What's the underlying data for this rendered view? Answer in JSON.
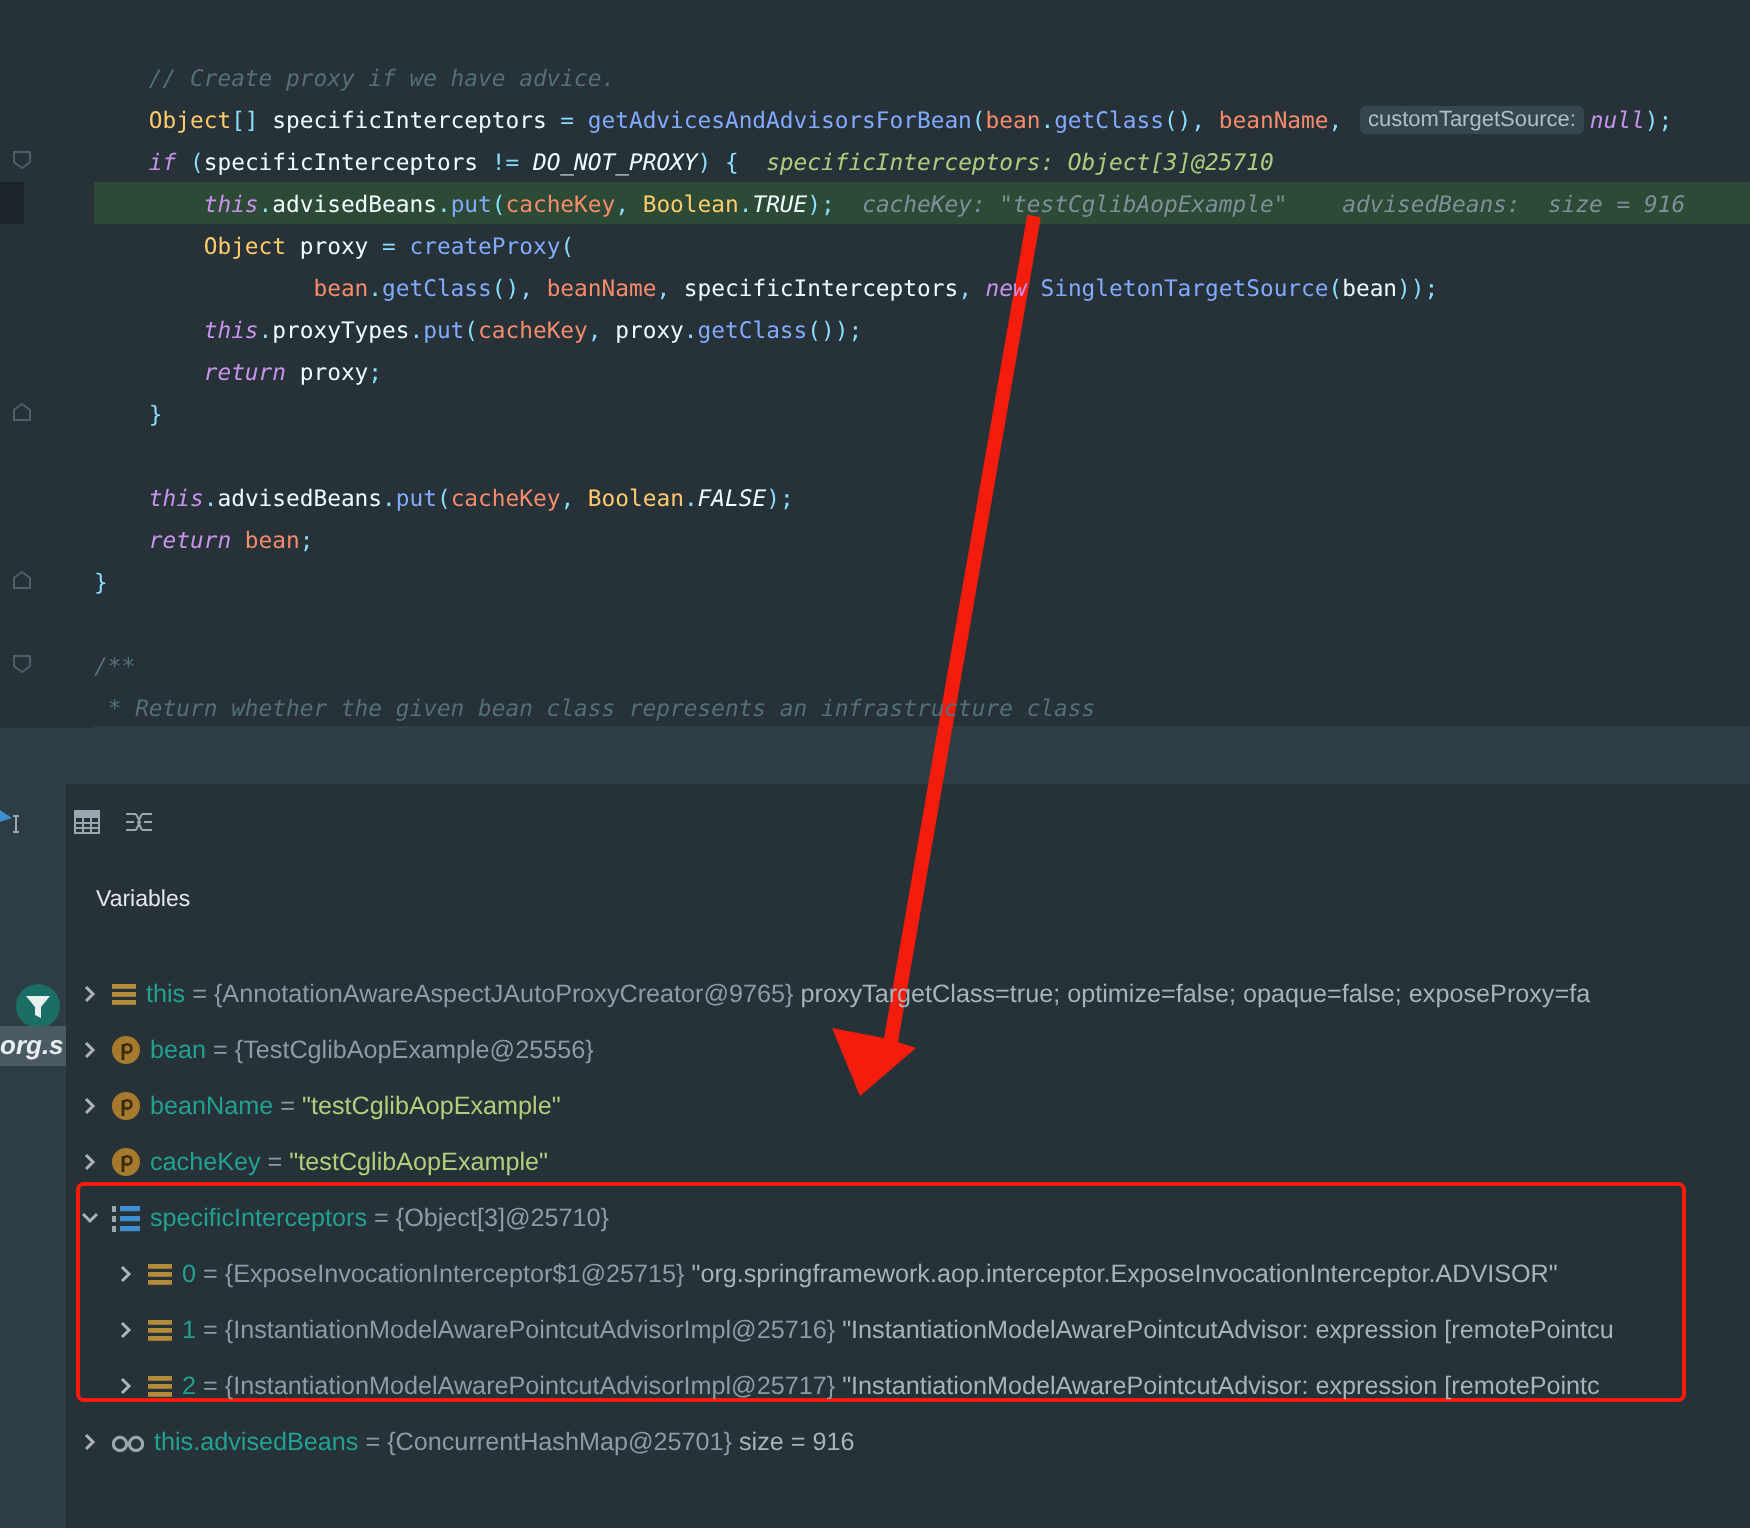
{
  "editor": {
    "lines": [
      {
        "highlighted": false,
        "kind": "plain",
        "segments": [
          {
            "kind": "comment",
            "text": "    // Create proxy if we have advice."
          }
        ]
      },
      {
        "highlighted": false,
        "kind": "plain",
        "segments": [
          {
            "kind": "type",
            "text": "    Object"
          },
          {
            "kind": "punct",
            "text": "[]"
          },
          {
            "kind": "plain",
            "text": " specificInterceptors "
          },
          {
            "kind": "punct",
            "text": "= "
          },
          {
            "kind": "method",
            "text": "getAdvicesAndAdvisorsForBean"
          },
          {
            "kind": "punct",
            "text": "("
          },
          {
            "kind": "param",
            "text": "bean"
          },
          {
            "kind": "punct",
            "text": "."
          },
          {
            "kind": "method",
            "text": "getClass"
          },
          {
            "kind": "punct",
            "text": "(), "
          },
          {
            "kind": "param",
            "text": "beanName"
          },
          {
            "kind": "punct",
            "text": ", "
          },
          {
            "kind": "inlay",
            "text": "customTargetSource:"
          },
          {
            "kind": "keyword",
            "text": "null"
          },
          {
            "kind": "punct",
            "text": ");"
          }
        ]
      },
      {
        "highlighted": false,
        "kind": "fold_start",
        "segments": [
          {
            "kind": "keyword",
            "text": "    if"
          },
          {
            "kind": "punct",
            "text": " ("
          },
          {
            "kind": "plain",
            "text": "specificInterceptors "
          },
          {
            "kind": "punct",
            "text": "!= "
          },
          {
            "kind": "constant",
            "text": "DO_NOT_PROXY"
          },
          {
            "kind": "punct",
            "text": ") {  "
          },
          {
            "kind": "hint",
            "text": "specificInterceptors: Object[3]@25710"
          }
        ]
      },
      {
        "highlighted": true,
        "kind": "plain",
        "segments": [
          {
            "kind": "keyword",
            "text": "        this"
          },
          {
            "kind": "punct",
            "text": "."
          },
          {
            "kind": "plain",
            "text": "advisedBeans"
          },
          {
            "kind": "punct",
            "text": "."
          },
          {
            "kind": "method",
            "text": "put"
          },
          {
            "kind": "punct",
            "text": "("
          },
          {
            "kind": "param",
            "text": "cacheKey"
          },
          {
            "kind": "punct",
            "text": ", "
          },
          {
            "kind": "type",
            "text": "Boolean"
          },
          {
            "kind": "punct",
            "text": "."
          },
          {
            "kind": "constant",
            "text": "TRUE"
          },
          {
            "kind": "punct",
            "text": ");  "
          },
          {
            "kind": "hint_dim",
            "text": "cacheKey: \"testCglibAopExample\"    advisedBeans:  size = 916"
          }
        ]
      },
      {
        "highlighted": false,
        "kind": "plain",
        "segments": [
          {
            "kind": "type",
            "text": "        Object"
          },
          {
            "kind": "plain",
            "text": " proxy "
          },
          {
            "kind": "punct",
            "text": "= "
          },
          {
            "kind": "method",
            "text": "createProxy"
          },
          {
            "kind": "punct",
            "text": "("
          }
        ]
      },
      {
        "highlighted": false,
        "kind": "plain",
        "segments": [
          {
            "kind": "param",
            "text": "                bean"
          },
          {
            "kind": "punct",
            "text": "."
          },
          {
            "kind": "method",
            "text": "getClass"
          },
          {
            "kind": "punct",
            "text": "(), "
          },
          {
            "kind": "param",
            "text": "beanName"
          },
          {
            "kind": "punct",
            "text": ", "
          },
          {
            "kind": "plain",
            "text": "specificInterceptors"
          },
          {
            "kind": "punct",
            "text": ", "
          },
          {
            "kind": "keyword",
            "text": "new "
          },
          {
            "kind": "method",
            "text": "SingletonTargetSource"
          },
          {
            "kind": "punct",
            "text": "("
          },
          {
            "kind": "plain",
            "text": "bean"
          },
          {
            "kind": "punct",
            "text": "));"
          }
        ]
      },
      {
        "highlighted": false,
        "kind": "plain",
        "segments": [
          {
            "kind": "keyword",
            "text": "        this"
          },
          {
            "kind": "punct",
            "text": "."
          },
          {
            "kind": "plain",
            "text": "proxyTypes"
          },
          {
            "kind": "punct",
            "text": "."
          },
          {
            "kind": "method",
            "text": "put"
          },
          {
            "kind": "punct",
            "text": "("
          },
          {
            "kind": "param",
            "text": "cacheKey"
          },
          {
            "kind": "punct",
            "text": ", "
          },
          {
            "kind": "plain",
            "text": "proxy"
          },
          {
            "kind": "punct",
            "text": "."
          },
          {
            "kind": "method",
            "text": "getClass"
          },
          {
            "kind": "punct",
            "text": "());"
          }
        ]
      },
      {
        "highlighted": false,
        "kind": "plain",
        "segments": [
          {
            "kind": "keyword",
            "text": "        return"
          },
          {
            "kind": "plain",
            "text": " proxy"
          },
          {
            "kind": "punct",
            "text": ";"
          }
        ]
      },
      {
        "highlighted": false,
        "kind": "fold_end",
        "segments": [
          {
            "kind": "punct",
            "text": "    }"
          }
        ]
      },
      {
        "highlighted": false,
        "kind": "plain"
      },
      {
        "highlighted": false,
        "kind": "plain",
        "segments": [
          {
            "kind": "keyword",
            "text": "    this"
          },
          {
            "kind": "punct",
            "text": "."
          },
          {
            "kind": "plain",
            "text": "advisedBeans"
          },
          {
            "kind": "punct",
            "text": "."
          },
          {
            "kind": "method",
            "text": "put"
          },
          {
            "kind": "punct",
            "text": "("
          },
          {
            "kind": "param",
            "text": "cacheKey"
          },
          {
            "kind": "punct",
            "text": ", "
          },
          {
            "kind": "type",
            "text": "Boolean"
          },
          {
            "kind": "punct",
            "text": "."
          },
          {
            "kind": "constant",
            "text": "FALSE"
          },
          {
            "kind": "punct",
            "text": ");"
          }
        ]
      },
      {
        "highlighted": false,
        "kind": "plain",
        "segments": [
          {
            "kind": "keyword",
            "text": "    return"
          },
          {
            "kind": "param",
            "text": " bean"
          },
          {
            "kind": "punct",
            "text": ";"
          }
        ]
      },
      {
        "highlighted": false,
        "kind": "fold_end",
        "segments": [
          {
            "kind": "punct",
            "text": "}"
          }
        ]
      },
      {
        "highlighted": false,
        "kind": "plain"
      },
      {
        "highlighted": false,
        "kind": "fold_start",
        "segments": [
          {
            "kind": "comment",
            "text": "/**"
          }
        ]
      },
      {
        "highlighted": false,
        "kind": "plain",
        "segments": [
          {
            "kind": "comment",
            "text": " * Return whether the given bean class represents an infrastructure class"
          }
        ]
      }
    ]
  },
  "frames_strip": {
    "item": {
      "label": "org.s",
      "selected": true
    }
  },
  "variables": {
    "title": "Variables",
    "items": [
      {
        "kind": "field",
        "name": "this",
        "sign": "=",
        "value": {
          "kind": "object",
          "text": "{AnnotationAwareAspectJAutoProxyCreator@9765}"
        },
        "detail": "proxyTargetClass=true; optimize=false; opaque=false; exposeProxy=fa",
        "expanded": false
      },
      {
        "kind": "param",
        "name": "bean",
        "sign": "=",
        "value": {
          "kind": "object",
          "text": "{TestCglibAopExample@25556}"
        },
        "expanded": false
      },
      {
        "kind": "param",
        "name": "beanName",
        "sign": "=",
        "value": {
          "kind": "string",
          "text": "\"testCglibAopExample\""
        },
        "expanded": false
      },
      {
        "kind": "param",
        "name": "cacheKey",
        "sign": "=",
        "value": {
          "kind": "string",
          "text": "\"testCglibAopExample\""
        },
        "expanded": false
      },
      {
        "kind": "array",
        "name": "specificInterceptors",
        "sign": "=",
        "value": {
          "kind": "object",
          "text": "{Object[3]@25710}"
        },
        "expanded": true,
        "children": [
          {
            "kind": "field",
            "name": "0",
            "sign": "=",
            "value": {
              "kind": "object",
              "text": "{ExposeInvocationInterceptor$1@25715}"
            },
            "detail": "\"org.springframework.aop.interceptor.ExposeInvocationInterceptor.ADVISOR\"",
            "expanded": false
          },
          {
            "kind": "field",
            "name": "1",
            "sign": "=",
            "value": {
              "kind": "object",
              "text": "{InstantiationModelAwarePointcutAdvisorImpl@25716}"
            },
            "detail": "\"InstantiationModelAwarePointcutAdvisor: expression [remotePointcu",
            "expanded": false
          },
          {
            "kind": "field",
            "name": "2",
            "sign": "=",
            "value": {
              "kind": "object",
              "text": "{InstantiationModelAwarePointcutAdvisorImpl@25717}"
            },
            "detail": "\"InstantiationModelAwarePointcutAdvisor: expression [remotePointc",
            "expanded": false
          }
        ]
      },
      {
        "kind": "watch",
        "name": "this.advisedBeans",
        "sign": "=",
        "value": {
          "kind": "object",
          "text": "{ConcurrentHashMap@25701}"
        },
        "detail": "size = 916",
        "expanded": false
      }
    ]
  }
}
